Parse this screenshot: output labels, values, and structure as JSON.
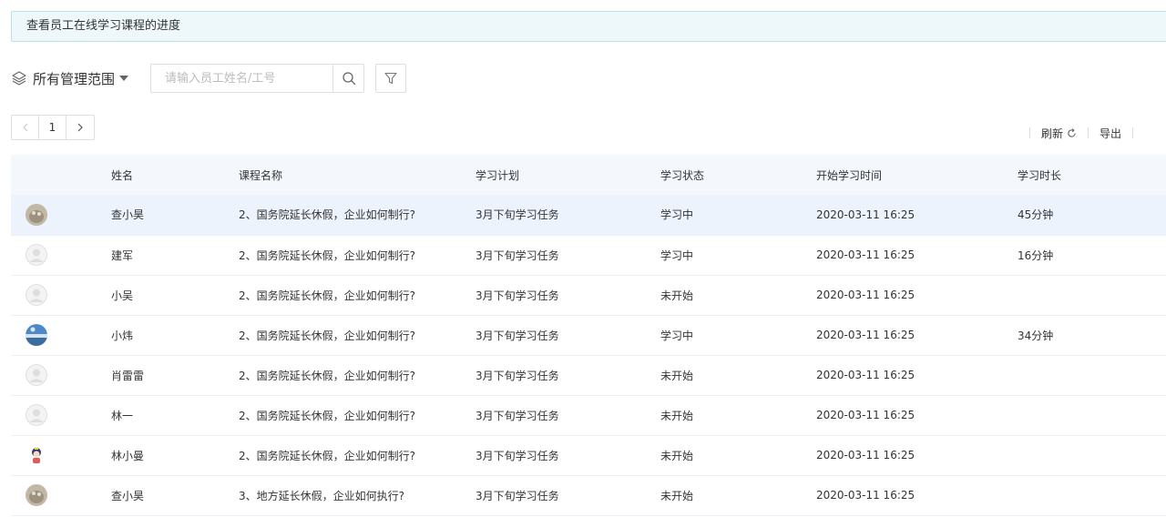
{
  "notice": {
    "text": "查看员工在线学习课程的进度"
  },
  "scope": {
    "label": "所有管理范围",
    "icon": "layers-icon"
  },
  "search": {
    "placeholder": "请输入员工姓名/工号",
    "value": ""
  },
  "pagination": {
    "current": "1"
  },
  "toolbar": {
    "refresh_label": "刷新",
    "export_label": "导出"
  },
  "table": {
    "headers": [
      "",
      "姓名",
      "课程名称",
      "学习计划",
      "学习状态",
      "开始学习时间",
      "学习时长"
    ],
    "rows": [
      {
        "name": "查小昊",
        "course": "2、国务院延长休假，企业如何制行?",
        "plan": "3月下旬学习任务",
        "status": "学习中",
        "start": "2020-03-11 16:25",
        "duration": "45分钟"
      },
      {
        "name": "建军",
        "course": "2、国务院延长休假，企业如何制行?",
        "plan": "3月下旬学习任务",
        "status": "学习中",
        "start": "2020-03-11 16:25",
        "duration": "16分钟"
      },
      {
        "name": "小吴",
        "course": "2、国务院延长休假，企业如何制行?",
        "plan": "3月下旬学习任务",
        "status": "未开始",
        "start": "2020-03-11 16:25",
        "duration": ""
      },
      {
        "name": "小炜",
        "course": "2、国务院延长休假，企业如何制行?",
        "plan": "3月下旬学习任务",
        "status": "学习中",
        "start": "2020-03-11 16:25",
        "duration": "34分钟"
      },
      {
        "name": "肖雷雷",
        "course": "2、国务院延长休假，企业如何制行?",
        "plan": "3月下旬学习任务",
        "status": "未开始",
        "start": "2020-03-11 16:25",
        "duration": ""
      },
      {
        "name": "林一",
        "course": "2、国务院延长休假，企业如何制行?",
        "plan": "3月下旬学习任务",
        "status": "未开始",
        "start": "2020-03-11 16:25",
        "duration": ""
      },
      {
        "name": "林小曼",
        "course": "2、国务院延长休假，企业如何制行?",
        "plan": "3月下旬学习任务",
        "status": "未开始",
        "start": "2020-03-11 16:25",
        "duration": ""
      },
      {
        "name": "查小昊",
        "course": "3、地方延长休假，企业如何执行?",
        "plan": "3月下旬学习任务",
        "status": "未开始",
        "start": "2020-03-11 16:25",
        "duration": ""
      }
    ]
  },
  "colors": {
    "accent": "#409eff",
    "notice_bg": "#eef8fb",
    "header_bg": "#f4f7fb",
    "active_row": "#edf3fd"
  }
}
